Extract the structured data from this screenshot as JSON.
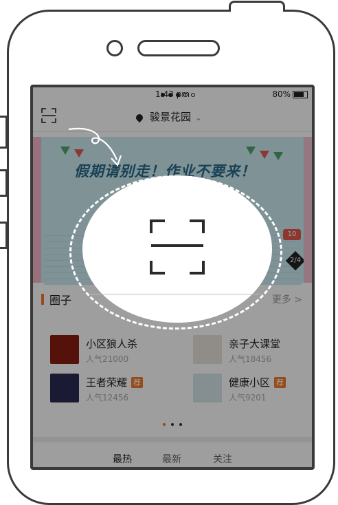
{
  "status": {
    "time": "1:43 pm",
    "battery": "80%"
  },
  "header": {
    "location": "骏景花园"
  },
  "banner": {
    "title": "假期请别走！作业不要来！",
    "page": "2/4",
    "tag": "10"
  },
  "circles": {
    "label": "圈子",
    "more": "更多 >",
    "items": [
      {
        "name": "小区狼人杀",
        "popularity": "人气21000",
        "hot": ""
      },
      {
        "name": "亲子大课堂",
        "popularity": "人气18456",
        "hot": ""
      },
      {
        "name": "王者荣耀",
        "popularity": "人气12456",
        "hot": "荐"
      },
      {
        "name": "健康小区",
        "popularity": "人气9201",
        "hot": "荐"
      }
    ]
  },
  "tabs": [
    "最热",
    "最新",
    "关注"
  ],
  "colors": {
    "accent": "#f07a2a",
    "frame": "#3a3a3a",
    "overlay": "rgba(0,0,0,0.38)"
  },
  "icons": {
    "header_left": "scan-icon",
    "location": "location-pin-icon",
    "overlay_center": "scan-icon"
  }
}
